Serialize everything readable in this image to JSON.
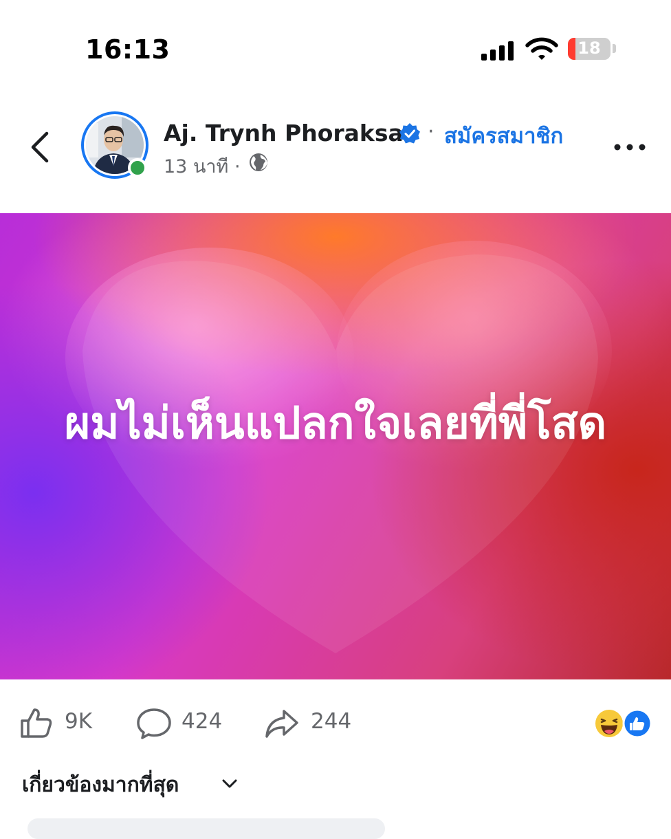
{
  "status_bar": {
    "time": "16:13",
    "battery": "18",
    "battery_level": 0.18
  },
  "post": {
    "author": "Aj. Trynh Phoraksa",
    "action_link": "สมัครสมาชิก",
    "separator": "·",
    "time_ago": "13 นาที ·",
    "text": "ผมไม่เห็นแปลกใจเลยที่พี่โสด"
  },
  "stats": {
    "likes": "9K",
    "comments": "424",
    "shares": "244"
  },
  "comments_sort": {
    "label": "เกี่ยวข้องมากที่สุด"
  },
  "icons": {
    "back": "chevron-left-icon",
    "verified": "verified-badge-icon",
    "privacy": "globe-icon",
    "more": "more-dots-icon",
    "like": "thumbs-up-icon",
    "comment": "comment-bubble-icon",
    "share": "share-arrow-icon",
    "reactions": [
      "haha-icon",
      "like-reaction-icon"
    ]
  },
  "colors": {
    "accent": "#1b74e4",
    "online": "#31a24c",
    "battery_low": "#ff3b30",
    "muted": "#65676b"
  }
}
